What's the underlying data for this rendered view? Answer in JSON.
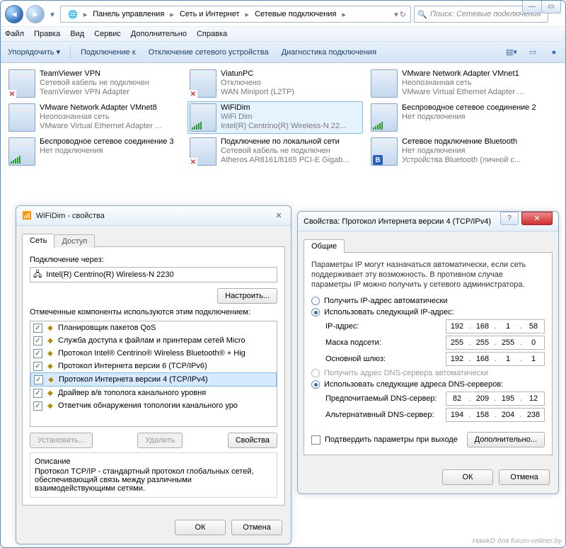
{
  "explorer": {
    "breadcrumb": [
      "Панель управления",
      "Сеть и Интернет",
      "Сетевые подключения"
    ],
    "search_placeholder": "Поиск: Сетевые подключения",
    "menu": [
      "Файл",
      "Правка",
      "Вид",
      "Сервис",
      "Дополнительно",
      "Справка"
    ],
    "toolbar": {
      "org": "Упорядочить",
      "connect": "Подключение к",
      "disable": "Отключение сетевого устройства",
      "diag": "Диагностика подключения"
    }
  },
  "connections": [
    {
      "name": "TeamViewer VPN",
      "l2": "Сетевой кабель не подключен",
      "l3": "TeamViewer VPN Adapter",
      "ico": "x"
    },
    {
      "name": "ViatunPC",
      "l2": "Отключено",
      "l3": "WAN Miniport (L2TP)",
      "ico": "x"
    },
    {
      "name": "VMware Network Adapter VMnet1",
      "l2": "Неопознанная сеть",
      "l3": "VMware Virtual Ethernet Adapter ...",
      "ico": "net"
    },
    {
      "name": "VMware Network Adapter VMnet8",
      "l2": "Неопознанная сеть",
      "l3": "VMware Virtual Ethernet Adapter ...",
      "ico": "net"
    },
    {
      "name": "WiFiDim",
      "l2": "WiFi Dim",
      "l3": "Intel(R) Centrino(R) Wireless-N 22...",
      "ico": "bars",
      "selected": true
    },
    {
      "name": "Беспроводное сетевое соединение 2",
      "l2": "Нет подключения",
      "l3": "",
      "ico": "bars"
    },
    {
      "name": "Беспроводное сетевое соединение 3",
      "l2": "Нет подключения",
      "l3": "",
      "ico": "bars"
    },
    {
      "name": "Подключение по локальной сети",
      "l2": "Сетевой кабель не подключен",
      "l3": "Atheros AR8161/8165 PCI-E Gigab...",
      "ico": "x"
    },
    {
      "name": "Сетевое подключение Bluetooth",
      "l2": "Нет подключения",
      "l3": "Устройства Bluetooth (личной с...",
      "ico": "bt"
    }
  ],
  "dlg_wifi": {
    "title": "WiFiDim - свойства",
    "tab_net": "Сеть",
    "tab_access": "Доступ",
    "connect_via_lbl": "Подключение через:",
    "adapter": "Intel(R) Centrino(R) Wireless-N 2230",
    "configure": "Настроить...",
    "components_lbl": "Отмеченные компоненты используются этим подключением:",
    "components": [
      "Планировщик пакетов QoS",
      "Служба доступа к файлам и принтерам сетей Micro",
      "Протокол Intel® Centrino® Wireless Bluetooth® + Hig",
      "Протокол Интернета версии 6 (TCP/IPv6)",
      "Протокол Интернета версии 4 (TCP/IPv4)",
      "Драйвер в/в тополога канального уровня",
      "Ответчик обнаружения топологии канального уро"
    ],
    "selected_index": 4,
    "install": "Установить...",
    "remove": "Удалить",
    "properties": "Свойства",
    "desc_title": "Описание",
    "desc_text": "Протокол TCP/IP - стандартный протокол глобальных сетей, обеспечивающий связь между различными взаимодействующими сетями.",
    "ok": "ОК",
    "cancel": "Отмена"
  },
  "dlg_ipv4": {
    "title": "Свойства: Протокол Интернета версии 4 (TCP/IPv4)",
    "tab": "Общие",
    "info": "Параметры IP могут назначаться автоматически, если сеть поддерживает эту возможность. В противном случае параметры IP можно получить у сетевого администратора.",
    "auto_ip": "Получить IP-адрес автоматически",
    "use_ip": "Использовать следующий IP-адрес:",
    "ip_lbl": "IP-адрес:",
    "ip_val": [
      "192",
      "168",
      "1",
      "58"
    ],
    "mask_lbl": "Маска подсети:",
    "mask_val": [
      "255",
      "255",
      "255",
      "0"
    ],
    "gw_lbl": "Основной шлюз:",
    "gw_val": [
      "192",
      "168",
      "1",
      "1"
    ],
    "auto_dns": "Получить адрес DNS-сервера автоматически",
    "use_dns": "Использовать следующие адреса DNS-серверов:",
    "dns1_lbl": "Предпочитаемый DNS-сервер:",
    "dns1_val": [
      "82",
      "209",
      "195",
      "12"
    ],
    "dns2_lbl": "Альтернативный DNS-сервер:",
    "dns2_val": [
      "194",
      "158",
      "204",
      "238"
    ],
    "confirm": "Подтвердить параметры при выходе",
    "advanced": "Дополнительно...",
    "ok": "ОК",
    "cancel": "Отмена"
  },
  "watermark": "HawkD для forum-onliner.by"
}
